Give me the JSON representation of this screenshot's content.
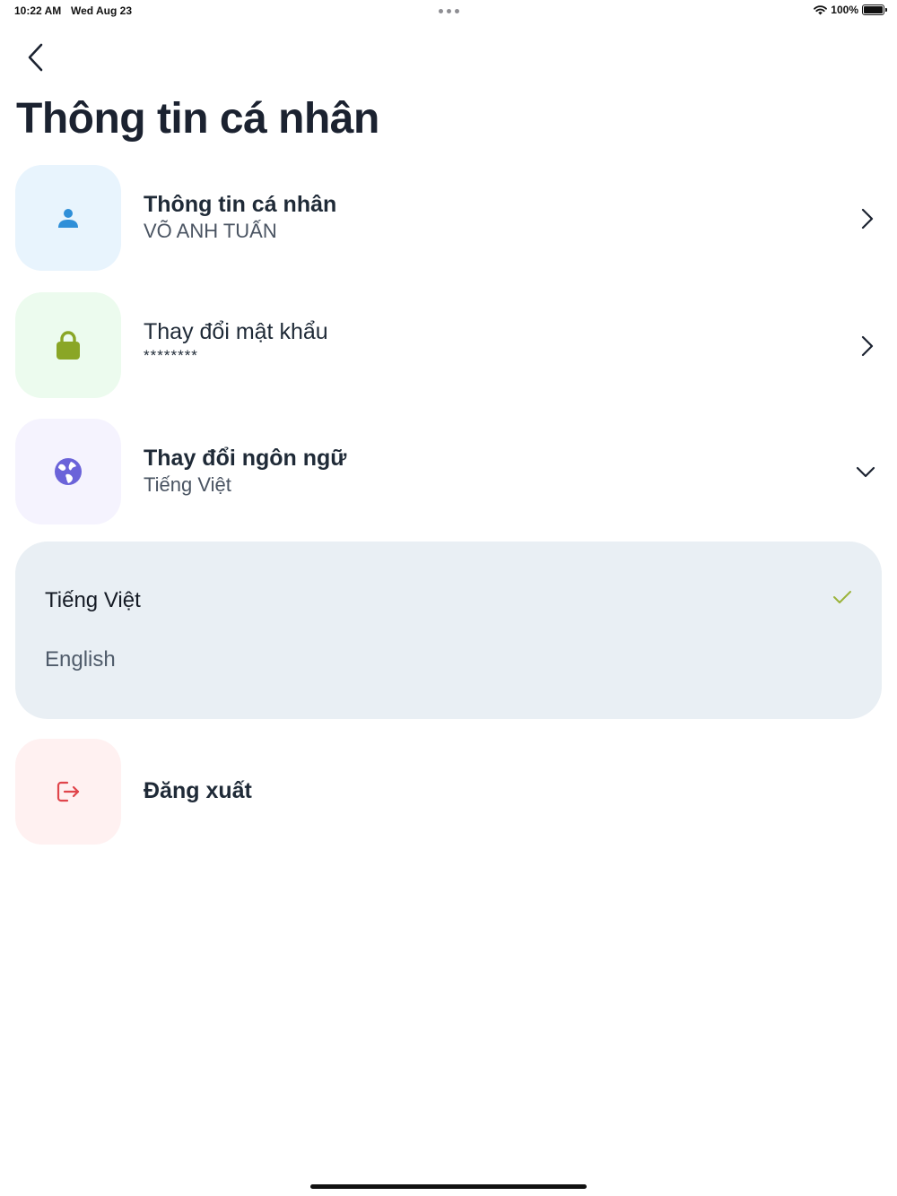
{
  "status_bar": {
    "time": "10:22 AM",
    "date": "Wed Aug 23",
    "battery": "100%",
    "icons": [
      "wifi-icon",
      "battery-icon"
    ]
  },
  "header": {
    "back_icon": "chevron-left-icon",
    "title": "Thông tin cá nhân"
  },
  "menu": {
    "profile": {
      "title": "Thông tin cá nhân",
      "subtitle": "VÕ ANH TUẤN",
      "icon": "user-icon",
      "tile_color": "#e8f4fd",
      "icon_color": "#2f8fd8"
    },
    "password": {
      "title": "Thay đổi mật khẩu",
      "subtitle": "********",
      "icon": "lock-icon",
      "tile_color": "#ecfbee",
      "icon_color": "#8aa626"
    },
    "language": {
      "title": "Thay đổi ngôn ngữ",
      "subtitle": "Tiếng Việt",
      "icon": "globe-icon",
      "tile_color": "#f5f3fe",
      "icon_color": "#6b63d9",
      "expanded": true,
      "options": [
        {
          "label": "Tiếng Việt",
          "selected": true
        },
        {
          "label": "English",
          "selected": false
        }
      ],
      "check_color": "#9bb33a"
    },
    "logout": {
      "title": "Đăng xuất",
      "icon": "logout-icon",
      "tile_color": "#fff1f1",
      "icon_color": "#e0454b"
    }
  }
}
